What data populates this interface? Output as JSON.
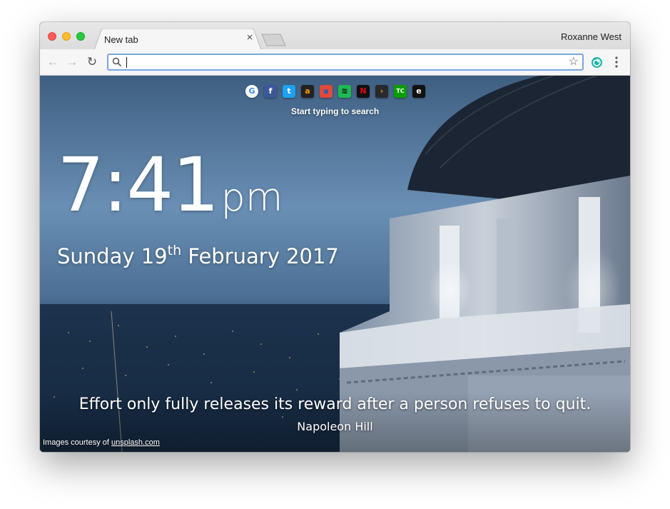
{
  "browser": {
    "tab_title": "New tab",
    "tab_close_glyph": "×",
    "profile_name": "Roxanne West",
    "address_value": "",
    "icons": [
      "back-arrow-icon",
      "forward-arrow-icon",
      "reload-icon",
      "search-icon",
      "bookmark-star-icon",
      "extension-spiral-icon",
      "menu-dots-icon"
    ]
  },
  "toolbar": {
    "back_glyph": "←",
    "forward_glyph": "→",
    "reload_glyph": "↻",
    "star_glyph": "☆"
  },
  "shortcuts": [
    {
      "name": "google",
      "glyph": "G",
      "bg": "#ffffff",
      "fg": "#4285f4"
    },
    {
      "name": "facebook",
      "glyph": "f",
      "bg": "#3b5998",
      "fg": "#ffffff"
    },
    {
      "name": "twitter",
      "glyph": "t",
      "bg": "#1da1f2",
      "fg": "#ffffff"
    },
    {
      "name": "amazon",
      "glyph": "a",
      "bg": "#222222",
      "fg": "#ff9900"
    },
    {
      "name": "shopping",
      "glyph": "▪",
      "bg": "#e04a3a",
      "fg": "#2a5fb0"
    },
    {
      "name": "spotify",
      "glyph": "≋",
      "bg": "#1db954",
      "fg": "#111111"
    },
    {
      "name": "netflix",
      "glyph": "N",
      "bg": "#111111",
      "fg": "#e50914"
    },
    {
      "name": "plex",
      "glyph": "›",
      "bg": "#282a2d",
      "fg": "#e5a00d"
    },
    {
      "name": "techcrunch",
      "glyph": "TC",
      "bg": "#0a9e01",
      "fg": "#ffffff"
    },
    {
      "name": "engadget",
      "glyph": "e",
      "bg": "#111111",
      "fg": "#ffffff"
    }
  ],
  "newtab": {
    "search_hint": "Start typing to search",
    "time": "7:41",
    "ampm": "pm",
    "day_name": "Sunday",
    "day_number": "19",
    "day_suffix": "th",
    "month_year": "February 2017",
    "quote": "Effort only fully releases its reward after a person refuses to quit.",
    "author": "Napoleon Hill",
    "credit_prefix": "Images courtesy of",
    "credit_link": "unsplash.com"
  },
  "colors": {
    "accent_focus": "#7ba6e0",
    "tab_bg": "#f6f6f6",
    "titlebar_bg": "#dcdcdc"
  }
}
